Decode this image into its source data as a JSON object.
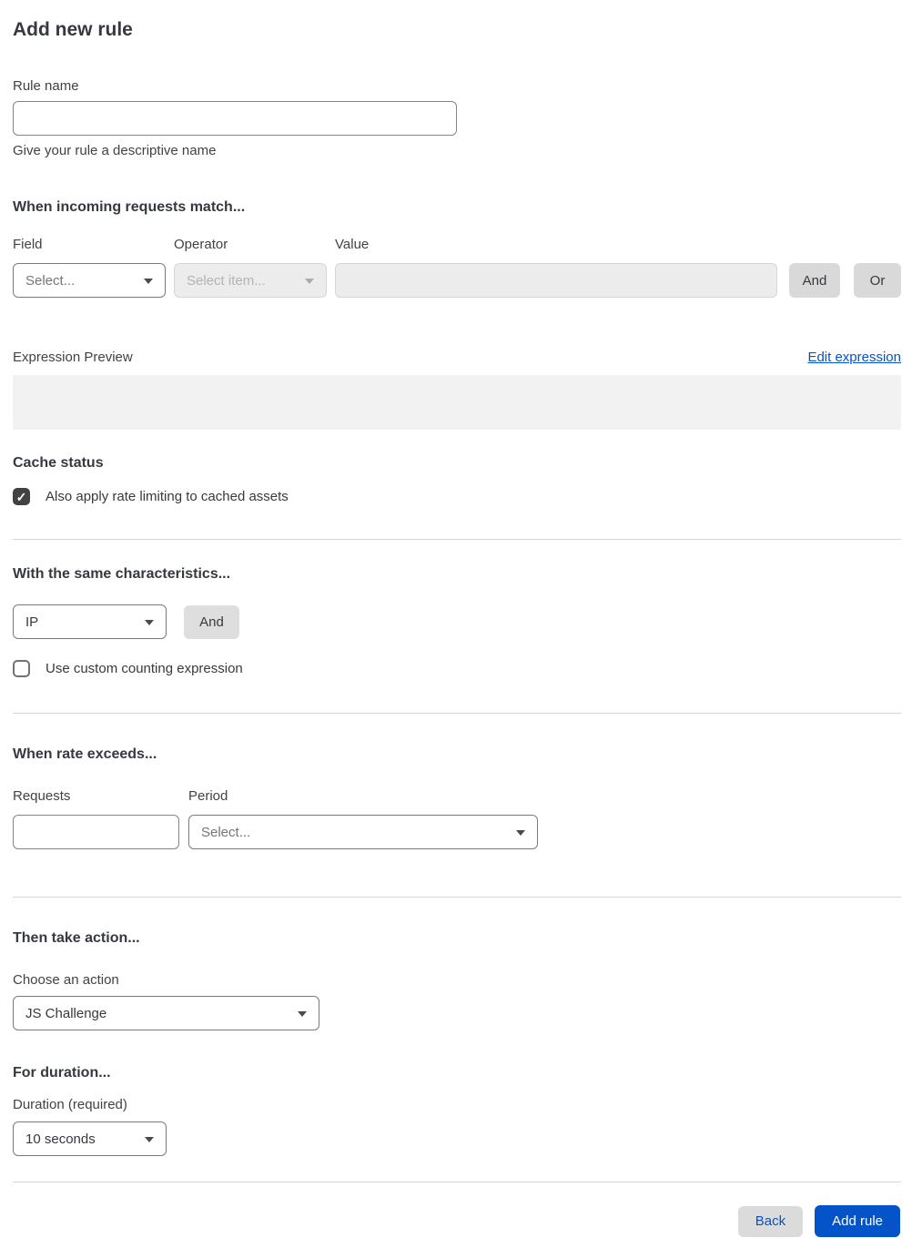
{
  "page": {
    "title": "Add new rule"
  },
  "rule_name": {
    "label": "Rule name",
    "value": "",
    "helper": "Give your rule a descriptive name"
  },
  "match": {
    "heading": "When incoming requests match...",
    "field": {
      "label": "Field",
      "value": "Select..."
    },
    "operator": {
      "label": "Operator",
      "placeholder": "Select item..."
    },
    "value": {
      "label": "Value",
      "value": ""
    },
    "and_label": "And",
    "or_label": "Or"
  },
  "expression": {
    "label": "Expression Preview",
    "edit_link": "Edit expression",
    "preview": ""
  },
  "cache": {
    "heading": "Cache status",
    "checkbox_label": "Also apply rate limiting to cached assets",
    "checked": true
  },
  "characteristics": {
    "heading": "With the same characteristics...",
    "select_value": "IP",
    "and_label": "And",
    "checkbox_label": "Use custom counting expression",
    "checked": false
  },
  "rate": {
    "heading": "When rate exceeds...",
    "requests": {
      "label": "Requests",
      "value": ""
    },
    "period": {
      "label": "Period",
      "value": "Select..."
    }
  },
  "action": {
    "heading": "Then take action...",
    "label": "Choose an action",
    "value": "JS Challenge"
  },
  "duration": {
    "heading": "For duration...",
    "label": "Duration (required)",
    "value": "10 seconds"
  },
  "footer": {
    "back_label": "Back",
    "add_label": "Add rule"
  },
  "icons": {
    "check": "✓"
  },
  "colors": {
    "accent_blue": "#0553c8",
    "disabled_bg": "#ececec",
    "button_gray": "#d9d9d9",
    "checkbox_checked": "#424242"
  }
}
